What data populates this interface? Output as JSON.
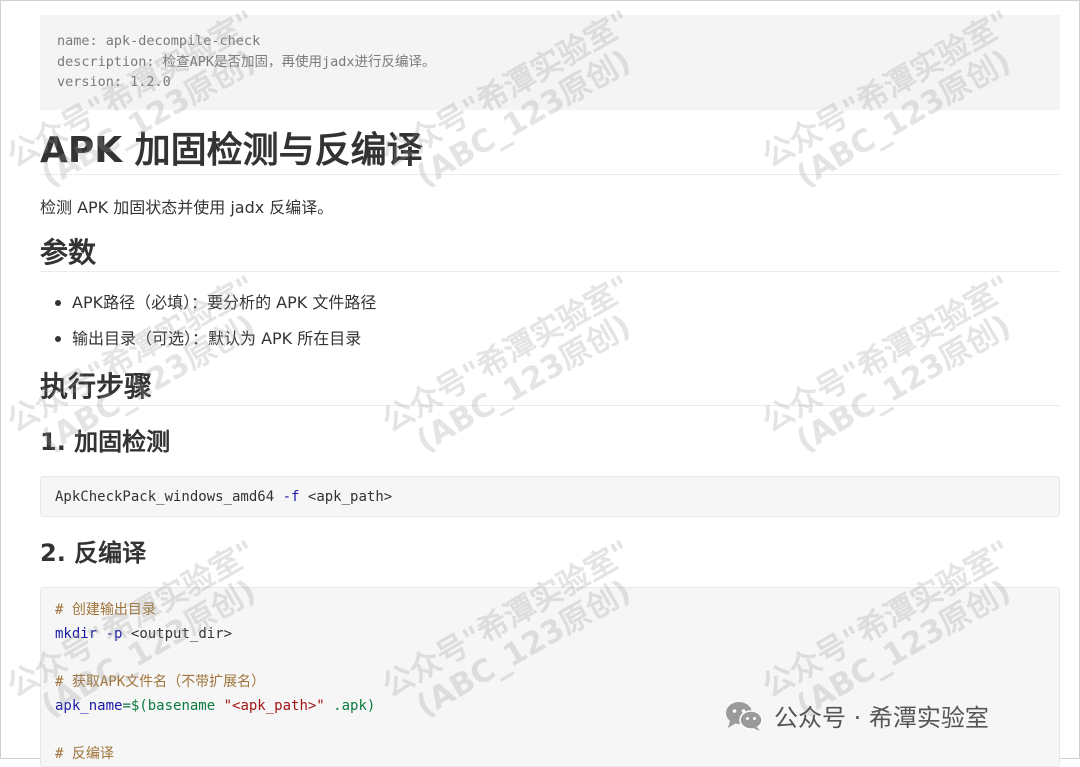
{
  "front_matter": {
    "name_line": "name: apk-decompile-check",
    "description_line": "description: 检查APK是否加固，再使用jadx进行反编译。",
    "version_line": "version: 1.2.0"
  },
  "title": "APK 加固检测与反编译",
  "intro": "检测 APK 加固状态并使用 jadx 反编译。",
  "params_heading": "参数",
  "params": [
    "APK路径（必填）：要分析的 APK 文件路径",
    "输出目录（可选）：默认为 APK 所在目录"
  ],
  "steps_heading": "执行步骤",
  "step1_heading": "1. 加固检测",
  "step1_code": {
    "cmd": "ApkCheckPack_windows_amd64",
    "flag": "-f",
    "arg": "<apk_path>"
  },
  "step2_heading": "2. 反编译",
  "step2_code": {
    "comment1": "# 创建输出目录",
    "mkdir_cmd": "mkdir",
    "mkdir_flag": "-p",
    "mkdir_arg": "<output_dir>",
    "comment2": "# 获取APK文件名（不带扩展名）",
    "var_name": "apk_name",
    "assign": "=$(basename ",
    "str": "\"<apk_path>\"",
    "tail": " .apk)",
    "comment3": "# 反编译"
  },
  "watermark": {
    "line1": "公众号\"希潭实验室\"",
    "line2": "(ABC_123原创)"
  },
  "brand": "公众号 · 希潭实验室"
}
